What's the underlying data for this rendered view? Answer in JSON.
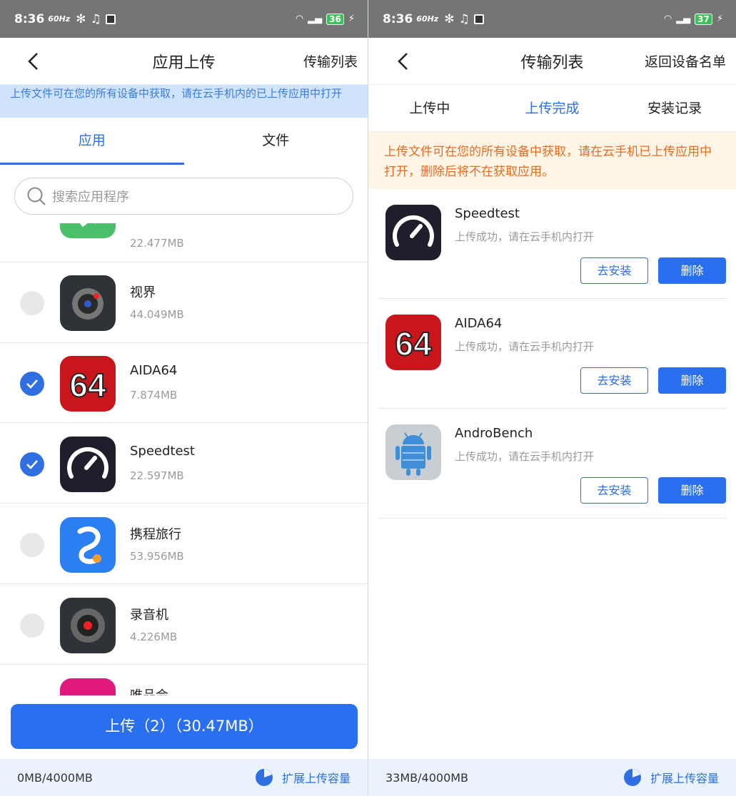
{
  "left": {
    "status": {
      "time": "8:36",
      "hz": "60Hz",
      "battery": "36"
    },
    "nav": {
      "title": "应用上传",
      "action": "传输列表"
    },
    "banner": "上传文件可在您的所有设备中获取，请在云手机内的已上传应用中打开",
    "tabs": [
      "应用",
      "文件"
    ],
    "search": {
      "placeholder": "搜索应用程序"
    },
    "apps": [
      {
        "name": "",
        "size": "22.477MB",
        "checked": false,
        "icon": "green-app-icon"
      },
      {
        "name": "视界",
        "size": "44.049MB",
        "checked": false,
        "icon": "camera-app-icon"
      },
      {
        "name": "AIDA64",
        "size": "7.874MB",
        "checked": true,
        "icon": "aida64-icon"
      },
      {
        "name": "Speedtest",
        "size": "22.597MB",
        "checked": true,
        "icon": "speedtest-icon"
      },
      {
        "name": "携程旅行",
        "size": "53.956MB",
        "checked": false,
        "icon": "ctrip-icon"
      },
      {
        "name": "录音机",
        "size": "4.226MB",
        "checked": false,
        "icon": "recorder-icon"
      },
      {
        "name": "唯品会",
        "size": "",
        "checked": false,
        "icon": "vip-icon"
      }
    ],
    "upload_button": "上传（2）（30.47MB）",
    "footer": {
      "usage": "0MB/4000MB",
      "expand": "扩展上传容量"
    }
  },
  "right": {
    "status": {
      "time": "8:36",
      "hz": "60Hz",
      "battery": "37"
    },
    "nav": {
      "title": "传输列表",
      "action": "返回设备名单"
    },
    "tabs": [
      "上传中",
      "上传完成",
      "安装记录"
    ],
    "banner": "上传文件可在您的所有设备中获取，请在云手机已上传应用中打开，删除后将不在获取应用。",
    "uploads": [
      {
        "name": "Speedtest",
        "status": "上传成功，请在云手机内打开",
        "install": "去安装",
        "delete": "删除"
      },
      {
        "name": "AIDA64",
        "status": "上传成功，请在云手机内打开",
        "install": "去安装",
        "delete": "删除"
      },
      {
        "name": "AndroBench",
        "status": "上传成功，请在云手机内打开",
        "install": "去安装",
        "delete": "删除"
      }
    ],
    "footer": {
      "usage": "33MB/4000MB",
      "expand": "扩展上传容量"
    }
  },
  "colors": {
    "accent": "#2a6ff0",
    "banner_blue": "#cfe3fb",
    "banner_orange_text": "#ee6a1f",
    "banner_orange_bg": "#fff5e6"
  }
}
